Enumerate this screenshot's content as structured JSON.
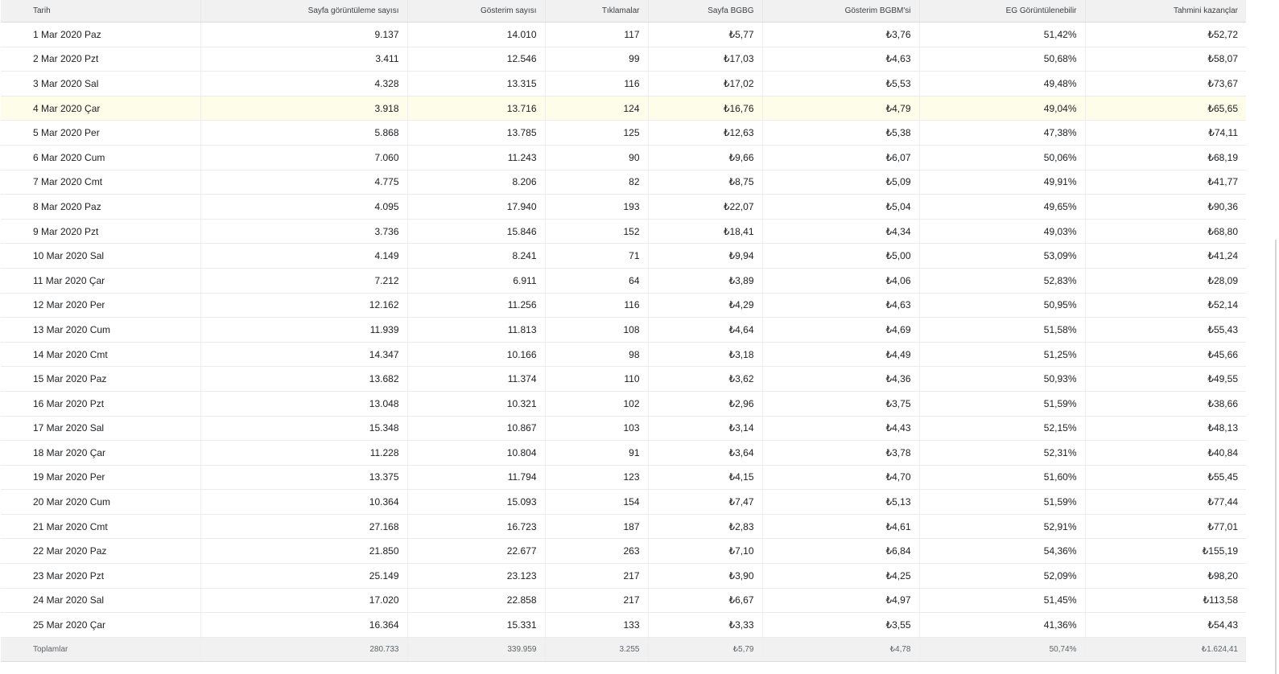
{
  "columns": [
    "Tarih",
    "Sayfa görüntüleme sayısı",
    "Gösterim sayısı",
    "Tıklamalar",
    "Sayfa BGBG",
    "Gösterim BGBM'si",
    "EG Görüntülenebilir",
    "Tahmini kazançlar"
  ],
  "rows": [
    [
      "1 Mar 2020 Paz",
      "9.137",
      "14.010",
      "117",
      "₺5,77",
      "₺3,76",
      "51,42%",
      "₺52,72"
    ],
    [
      "2 Mar 2020 Pzt",
      "3.411",
      "12.546",
      "99",
      "₺17,03",
      "₺4,63",
      "50,68%",
      "₺58,07"
    ],
    [
      "3 Mar 2020 Sal",
      "4.328",
      "13.315",
      "116",
      "₺17,02",
      "₺5,53",
      "49,48%",
      "₺73,67"
    ],
    [
      "4 Mar 2020 Çar",
      "3.918",
      "13.716",
      "124",
      "₺16,76",
      "₺4,79",
      "49,04%",
      "₺65,65"
    ],
    [
      "5 Mar 2020 Per",
      "5.868",
      "13.785",
      "125",
      "₺12,63",
      "₺5,38",
      "47,38%",
      "₺74,11"
    ],
    [
      "6 Mar 2020 Cum",
      "7.060",
      "11.243",
      "90",
      "₺9,66",
      "₺6,07",
      "50,06%",
      "₺68,19"
    ],
    [
      "7 Mar 2020 Cmt",
      "4.775",
      "8.206",
      "82",
      "₺8,75",
      "₺5,09",
      "49,91%",
      "₺41,77"
    ],
    [
      "8 Mar 2020 Paz",
      "4.095",
      "17.940",
      "193",
      "₺22,07",
      "₺5,04",
      "49,65%",
      "₺90,36"
    ],
    [
      "9 Mar 2020 Pzt",
      "3.736",
      "15.846",
      "152",
      "₺18,41",
      "₺4,34",
      "49,03%",
      "₺68,80"
    ],
    [
      "10 Mar 2020 Sal",
      "4.149",
      "8.241",
      "71",
      "₺9,94",
      "₺5,00",
      "53,09%",
      "₺41,24"
    ],
    [
      "11 Mar 2020 Çar",
      "7.212",
      "6.911",
      "64",
      "₺3,89",
      "₺4,06",
      "52,83%",
      "₺28,09"
    ],
    [
      "12 Mar 2020 Per",
      "12.162",
      "11.256",
      "116",
      "₺4,29",
      "₺4,63",
      "50,95%",
      "₺52,14"
    ],
    [
      "13 Mar 2020 Cum",
      "11.939",
      "11.813",
      "108",
      "₺4,64",
      "₺4,69",
      "51,58%",
      "₺55,43"
    ],
    [
      "14 Mar 2020 Cmt",
      "14.347",
      "10.166",
      "98",
      "₺3,18",
      "₺4,49",
      "51,25%",
      "₺45,66"
    ],
    [
      "15 Mar 2020 Paz",
      "13.682",
      "11.374",
      "110",
      "₺3,62",
      "₺4,36",
      "50,93%",
      "₺49,55"
    ],
    [
      "16 Mar 2020 Pzt",
      "13.048",
      "10.321",
      "102",
      "₺2,96",
      "₺3,75",
      "51,59%",
      "₺38,66"
    ],
    [
      "17 Mar 2020 Sal",
      "15.348",
      "10.867",
      "103",
      "₺3,14",
      "₺4,43",
      "52,15%",
      "₺48,13"
    ],
    [
      "18 Mar 2020 Çar",
      "11.228",
      "10.804",
      "91",
      "₺3,64",
      "₺3,78",
      "52,31%",
      "₺40,84"
    ],
    [
      "19 Mar 2020 Per",
      "13.375",
      "11.794",
      "123",
      "₺4,15",
      "₺4,70",
      "51,60%",
      "₺55,45"
    ],
    [
      "20 Mar 2020 Cum",
      "10.364",
      "15.093",
      "154",
      "₺7,47",
      "₺5,13",
      "51,59%",
      "₺77,44"
    ],
    [
      "21 Mar 2020 Cmt",
      "27.168",
      "16.723",
      "187",
      "₺2,83",
      "₺4,61",
      "52,91%",
      "₺77,01"
    ],
    [
      "22 Mar 2020 Paz",
      "21.850",
      "22.677",
      "263",
      "₺7,10",
      "₺6,84",
      "54,36%",
      "₺155,19"
    ],
    [
      "23 Mar 2020 Pzt",
      "25.149",
      "23.123",
      "217",
      "₺3,90",
      "₺4,25",
      "52,09%",
      "₺98,20"
    ],
    [
      "24 Mar 2020 Sal",
      "17.020",
      "22.858",
      "217",
      "₺6,67",
      "₺4,97",
      "51,45%",
      "₺113,58"
    ],
    [
      "25 Mar 2020 Çar",
      "16.364",
      "15.331",
      "133",
      "₺3,33",
      "₺3,55",
      "41,36%",
      "₺54,43"
    ]
  ],
  "highlighted_row_index": 3,
  "totals": [
    "Toplamlar",
    "280.733",
    "339.959",
    "3.255",
    "₺5,79",
    "₺4,78",
    "50,74%",
    "₺1.624,41"
  ],
  "colors": {
    "header_bg": "#f1f1f1",
    "highlight_bg": "#fefde9",
    "text": "#202124",
    "muted_text": "#5f6368"
  }
}
